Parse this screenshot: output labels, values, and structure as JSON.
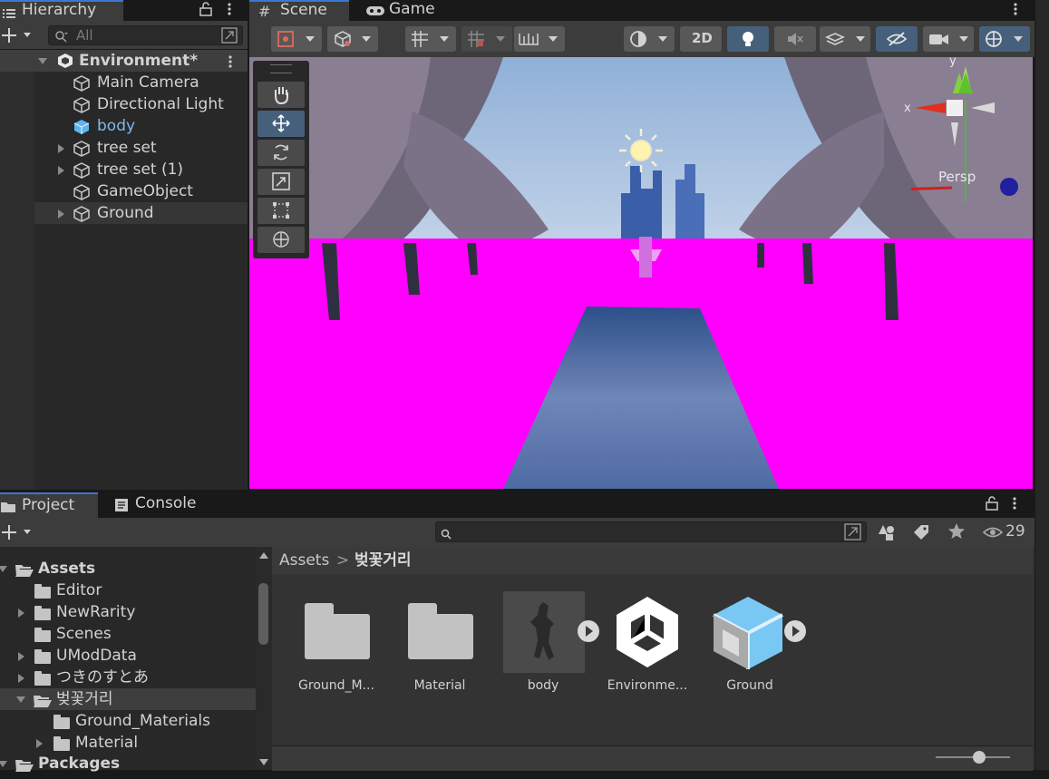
{
  "hierarchy": {
    "tab_label": "Hierarchy",
    "search_placeholder": "All",
    "scene_name": "Environment*",
    "items": [
      {
        "label": "Main Camera"
      },
      {
        "label": "Directional Light"
      },
      {
        "label": "body"
      },
      {
        "label": "tree set"
      },
      {
        "label": "tree set (1)"
      },
      {
        "label": "GameObject"
      },
      {
        "label": "Ground"
      }
    ]
  },
  "scene_view": {
    "tabs": [
      {
        "label": "Scene"
      },
      {
        "label": "Game"
      }
    ],
    "toolbar": {
      "mode_2d_label": "2D"
    },
    "gizmo": {
      "x_label": "x",
      "y_label": "y",
      "persp_label": "Persp"
    },
    "colors": {
      "missing_material": "#ff00ff",
      "accent": "#3a78d6"
    }
  },
  "project": {
    "tabs": [
      {
        "label": "Project"
      },
      {
        "label": "Console"
      }
    ],
    "search_placeholder": "",
    "hidden_count": "29",
    "tree": [
      {
        "label": "Assets"
      },
      {
        "label": "Editor"
      },
      {
        "label": "NewRarity"
      },
      {
        "label": "Scenes"
      },
      {
        "label": "UModData"
      },
      {
        "label": "つきのすとあ"
      },
      {
        "label": "벚꽃거리"
      },
      {
        "label": "Ground_Materials"
      },
      {
        "label": "Material"
      },
      {
        "label": "Packages"
      }
    ],
    "breadcrumb": {
      "root": "Assets",
      "separator": ">",
      "current": "벚꽃거리"
    },
    "assets": [
      {
        "label": "Ground_M..."
      },
      {
        "label": "Material"
      },
      {
        "label": "body"
      },
      {
        "label": "Environme..."
      },
      {
        "label": "Ground"
      }
    ],
    "zoom_level": 0.6
  }
}
